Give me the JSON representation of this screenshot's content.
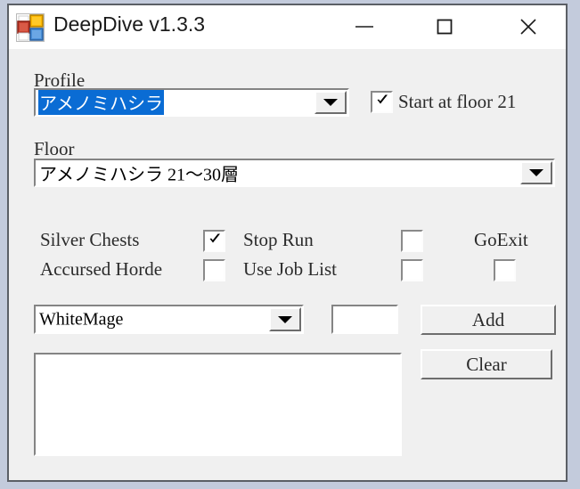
{
  "window": {
    "title": "DeepDive v1.3.3",
    "icon": "app-squares-icon",
    "colors": {
      "desktop_background": "#c3cbdc",
      "window_border": "#5b5f66",
      "client_background": "#f0f0f0",
      "titlebar_background": "#ffffff",
      "selection_blue": "#0a6cd4",
      "icon_red": "#c8402f",
      "icon_yellow": "#ffb900",
      "icon_blue": "#4a90d9"
    },
    "controls": {
      "minimize": "minimize-icon",
      "maximize": "maximize-icon",
      "close": "close-icon"
    }
  },
  "profile": {
    "label": "Profile",
    "value": "アメノミハシラ",
    "selected": true
  },
  "start_at_floor": {
    "label": "Start at floor 21",
    "checked": true
  },
  "floor": {
    "label": "Floor",
    "value": "アメノミハシラ 21〜30層"
  },
  "options": [
    {
      "label": "Silver Chests",
      "checked": true
    },
    {
      "label": "Accursed Horde",
      "checked": false
    },
    {
      "label": "Stop Run",
      "checked": false
    },
    {
      "label": "Use Job List",
      "checked": false
    },
    {
      "label": "GoExit",
      "checked": false
    }
  ],
  "job": {
    "combo_value": "WhiteMage",
    "text_value": "",
    "text_placeholder": "",
    "add_label": "Add",
    "clear_label": "Clear"
  },
  "job_list": {
    "items": []
  }
}
